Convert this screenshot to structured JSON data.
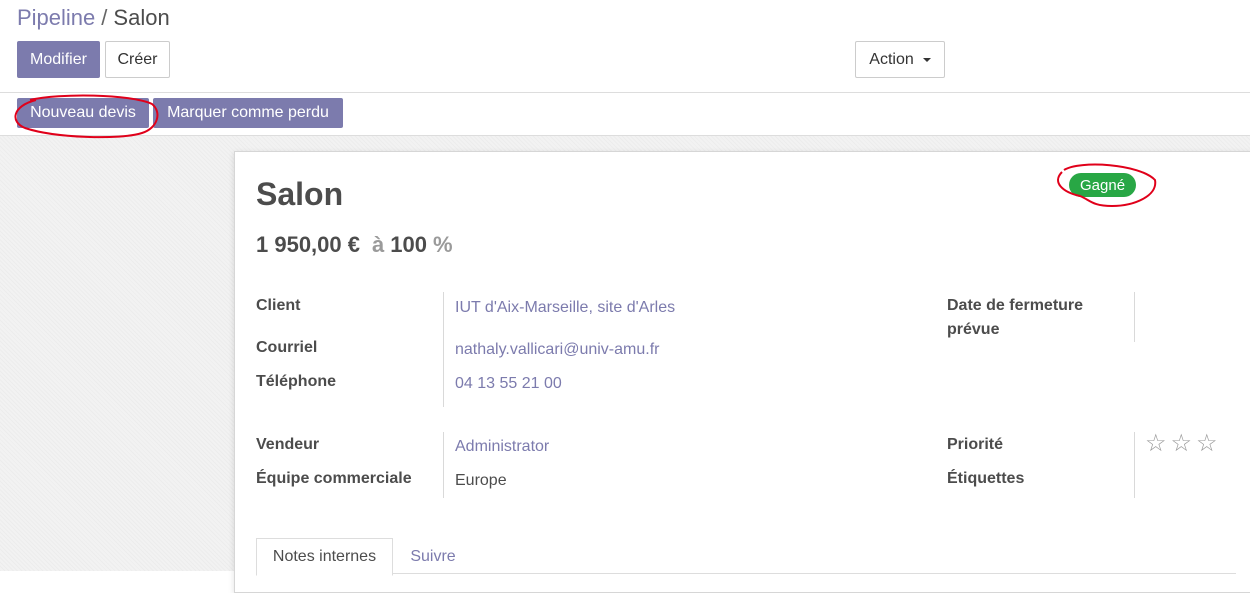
{
  "breadcrumb": {
    "parent": "Pipeline",
    "separator": "/",
    "current": "Salon"
  },
  "toolbar": {
    "edit_label": "Modifier",
    "create_label": "Créer",
    "action_label": "Action"
  },
  "statusbar": {
    "new_quote_label": "Nouveau devis",
    "mark_lost_label": "Marquer comme perdu"
  },
  "ribbon": {
    "label": "Gagné",
    "color": "#28a745"
  },
  "record": {
    "title": "Salon",
    "revenue": "1 950,00 €",
    "at_label": "à",
    "probability": "100",
    "percent_sign": "%"
  },
  "fields": {
    "client_label": "Client",
    "client_value": "IUT d'Aix-Marseille, site d'Arles",
    "email_label": "Courriel",
    "email_value": "nathaly.vallicari@univ-amu.fr",
    "phone_label": "Téléphone",
    "phone_value": "04 13 55 21 00",
    "close_date_label_1": "Date de fermeture",
    "close_date_label_2": "prévue",
    "salesperson_label": "Vendeur",
    "salesperson_value": "Administrator",
    "team_label": "Équipe commerciale",
    "team_value": "Europe",
    "priority_label": "Priorité",
    "tags_label": "Étiquettes"
  },
  "priority": {
    "stars_total": 3,
    "stars_filled": 0,
    "star_glyph": "☆"
  },
  "tabs": [
    {
      "label": "Notes internes",
      "active": true
    },
    {
      "label": "Suivre",
      "active": false
    }
  ],
  "colors": {
    "accent": "#7c7bad",
    "text": "#4c4c4c",
    "annotation": "#e0001a"
  }
}
